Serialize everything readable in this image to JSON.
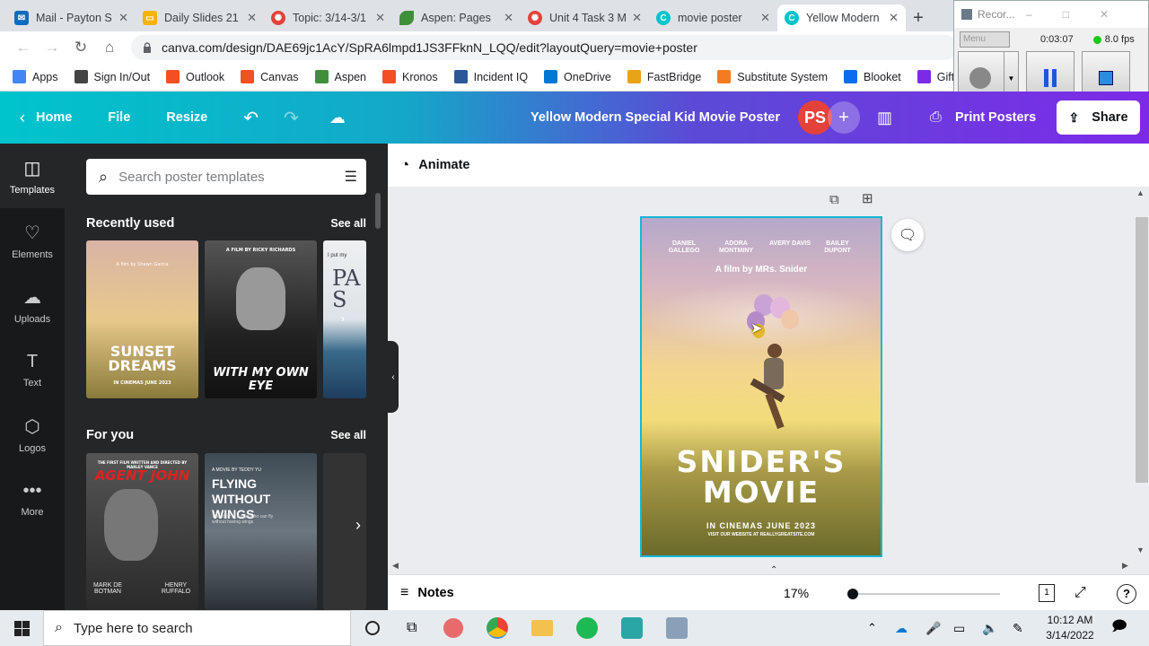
{
  "browser": {
    "tabs": [
      {
        "title": "Mail - Payton S",
        "icon_color": "#0f6cbd",
        "icon": "mail-icon"
      },
      {
        "title": "Daily Slides 21",
        "icon_color": "#f4b400",
        "icon": "slides-icon"
      },
      {
        "title": "Topic: 3/14-3/1",
        "icon_color": "#e5413b",
        "icon": "canvas-icon"
      },
      {
        "title": "Aspen: Pages",
        "icon_color": "#3f8f3a",
        "icon": "aspen-icon"
      },
      {
        "title": "Unit 4 Task 3 M",
        "icon_color": "#e5413b",
        "icon": "canvas-icon"
      },
      {
        "title": "movie poster",
        "icon_color": "#00c4cc",
        "icon": "canva-icon"
      },
      {
        "title": "Yellow Modern",
        "icon_color": "#00c4cc",
        "icon": "canva-icon"
      }
    ],
    "new_tab": "+",
    "url": "canva.com/design/DAE69jc1AcY/SpRA6lmpd1JS3FFknN_LQQ/edit?layoutQuery=movie+poster",
    "bookmarks": [
      {
        "label": "Apps",
        "color": "#4285f4"
      },
      {
        "label": "Sign In/Out",
        "color": "#444"
      },
      {
        "label": "Outlook",
        "color": "#f25022"
      },
      {
        "label": "Canvas",
        "color": "#f25022"
      },
      {
        "label": "Aspen",
        "color": "#3f8f3a"
      },
      {
        "label": "Kronos",
        "color": "#f25022"
      },
      {
        "label": "Incident IQ",
        "color": "#2b5797"
      },
      {
        "label": "OneDrive",
        "color": "#0078d4"
      },
      {
        "label": "FastBridge",
        "color": "#e8a317"
      },
      {
        "label": "Substitute System",
        "color": "#f47b20"
      },
      {
        "label": "Blooket",
        "color": "#0b6cf0"
      },
      {
        "label": "Gifted C",
        "color": "#7d2ae8"
      }
    ]
  },
  "recorder": {
    "title": "Recor...",
    "menu": "Menu",
    "time": "0:03:07",
    "fps": "8.0 fps"
  },
  "canva": {
    "home": "Home",
    "file": "File",
    "resize": "Resize",
    "doc_title": "Yellow Modern Special Kid Movie Poster",
    "avatar": "PS",
    "print": "Print Posters",
    "share": "Share",
    "sidebar": [
      {
        "label": "Templates",
        "icon": "templates-icon"
      },
      {
        "label": "Elements",
        "icon": "elements-icon"
      },
      {
        "label": "Uploads",
        "icon": "uploads-icon"
      },
      {
        "label": "Text",
        "icon": "text-icon"
      },
      {
        "label": "Logos",
        "icon": "logos-icon"
      },
      {
        "label": "More",
        "icon": "more-icon"
      }
    ],
    "search_placeholder": "Search poster templates",
    "recently_used": "Recently used",
    "for_you": "For you",
    "see_all": "See all",
    "templates_recent": [
      {
        "title": "SUNSET DREAMS",
        "sub": "IN CINEMAS JUNE 2023",
        "top": "A film by Shawn Garcia"
      },
      {
        "title": "WITH MY OWN EYE",
        "sub": "",
        "top": "A FILM BY RICKY RICHARDS"
      },
      {
        "title": "PA S",
        "sub": "",
        "top": "I put my"
      }
    ],
    "templates_foryou": [
      {
        "title": "AGENT JOHN",
        "names": [
          "MARK DE BOTMAN",
          "HENRY RUFFALO"
        ],
        "top": "THE FIRST FILM WRITTEN AND DIRECTED BY MARLEY VANCE"
      },
      {
        "title": "FLYING WITHOUT WINGS",
        "sub": "The story of a man who can fly without having wings",
        "top": "A MOVIE BY TEDDY YU"
      }
    ],
    "animate": "Animate",
    "notes": "Notes",
    "zoom": "17%",
    "page_number": "1",
    "poster": {
      "cast": [
        "DANIEL GALLEGO",
        "ADORA MONTMINY",
        "AVERY DAVIS",
        "BAILEY DUPONT"
      ],
      "byline": "A film by MRs. Snider",
      "title_line1": "SNIDER'S",
      "title_line2": "MOVIE",
      "release": "IN CINEMAS JUNE 2023",
      "website": "VISIT OUR WEBSITE AT REALLYGREATSITE.COM"
    }
  },
  "taskbar": {
    "search_placeholder": "Type here to search",
    "time": "10:12 AM",
    "date": "3/14/2022"
  }
}
